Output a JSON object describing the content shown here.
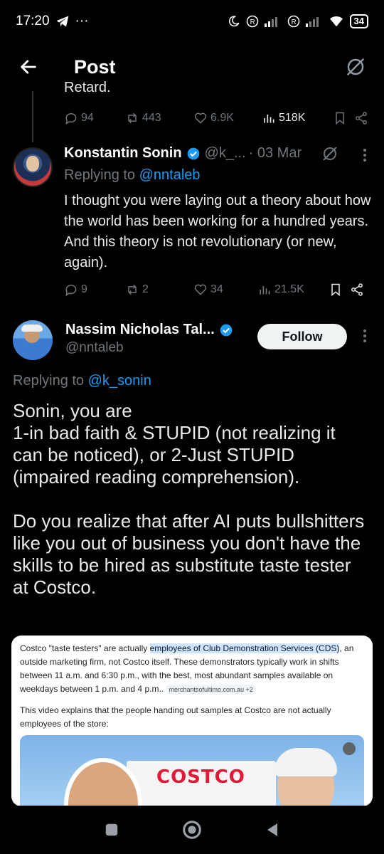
{
  "status_bar": {
    "time": "17:20",
    "dots": "···",
    "battery": "34"
  },
  "header": {
    "title": "Post"
  },
  "previous_tweet": {
    "text_tail": "Retard.",
    "replies": "94",
    "reposts": "443",
    "likes": "6.9K",
    "views": "518K"
  },
  "reply_tweet": {
    "name": "Konstantin Sonin",
    "handle": "@k_...",
    "date": "· 03 Mar",
    "replying_prefix": "Replying to ",
    "replying_to": "@nntaleb",
    "body": "I thought you were laying out a theory about how the world has been working for a hundred years. And this theory is not revolutionary (or new, again).",
    "replies": "9",
    "reposts": "2",
    "likes": "34",
    "views": "21.5K"
  },
  "main_tweet": {
    "name": "Nassim Nicholas Tal...",
    "handle": "@nntaleb",
    "follow_label": "Follow",
    "replying_prefix": "Replying to ",
    "replying_to": "@k_sonin",
    "paragraph1": "Sonin, you are\n1-in bad faith & STUPID (not realizing it can be noticed), or 2-Just STUPID (impaired reading comprehension).",
    "paragraph2": "Do you realize that after AI puts bullshitters like you out of business you don't have the skills to be hired as substitute taste tester at Costco."
  },
  "embedded_card": {
    "text_a": "Costco \"taste testers\" are actually ",
    "highlight": "employees of Club Demonstration Services (CDS)",
    "text_b": ", an outside marketing firm, not Costco itself. These demonstrators typically work in shifts between 11 a.m. and 6:30 p.m., with the best, most abundant samples available on weekdays between 1 p.m. and 4 p.m..",
    "source_chip": "merchantsofultimo.com.au +2",
    "paragraph2": "This video explains that the people handing out samples at Costco are not actually employees of the store:",
    "video_logo": "COSTCO"
  },
  "colors": {
    "accent": "#1d9bf0",
    "muted": "#71767b",
    "verified": "#1d9bf0"
  }
}
